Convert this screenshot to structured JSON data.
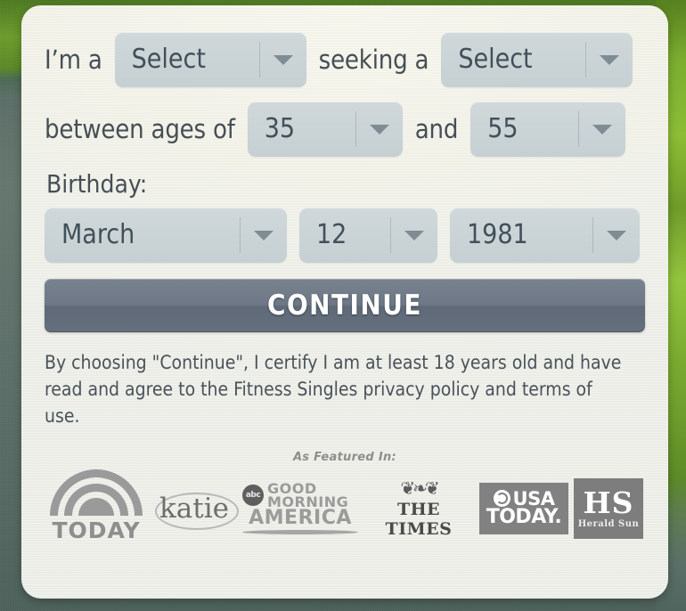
{
  "form": {
    "label_im_a": "I’m a",
    "gender_self": {
      "value": "Select",
      "icon": "chevron-down-icon"
    },
    "label_seeking": "seeking a",
    "gender_seeking": {
      "value": "Select",
      "icon": "chevron-down-icon"
    },
    "label_between_ages": "between ages of",
    "age_min": {
      "value": "35",
      "icon": "chevron-down-icon"
    },
    "label_and": "and",
    "age_max": {
      "value": "55",
      "icon": "chevron-down-icon"
    },
    "label_birthday": "Birthday:",
    "birth_month": {
      "value": "March",
      "icon": "chevron-down-icon"
    },
    "birth_day": {
      "value": "12",
      "icon": "chevron-down-icon"
    },
    "birth_year": {
      "value": "1981",
      "icon": "chevron-down-icon"
    },
    "continue_label": "CONTINUE",
    "disclaimer": "By choosing \"Continue\", I certify I am at least 18 years old and have read and agree to the Fitness Singles privacy policy and terms of use."
  },
  "featured": {
    "heading": "As Featured In:",
    "logos": [
      {
        "name": "today-logo",
        "word": "TODAY"
      },
      {
        "name": "katie-logo",
        "word": "katie"
      },
      {
        "name": "good-morning-america-logo",
        "abc": "abc",
        "line1": "GOOD",
        "line2": "MORNING",
        "line3": "AMERICA"
      },
      {
        "name": "the-times-logo",
        "crest": "❦❧❦",
        "word": "THE TIMES"
      },
      {
        "name": "usa-today-logo",
        "line1": "USA",
        "line2": "TODAY."
      },
      {
        "name": "herald-sun-logo",
        "initials": "HS",
        "word": "Herald Sun"
      }
    ]
  },
  "colors": {
    "card_bg": "#f1f2ea",
    "select_bg": "#cad3d6",
    "text": "#464f56",
    "button": "#6e7886",
    "caret": "#808c93"
  }
}
